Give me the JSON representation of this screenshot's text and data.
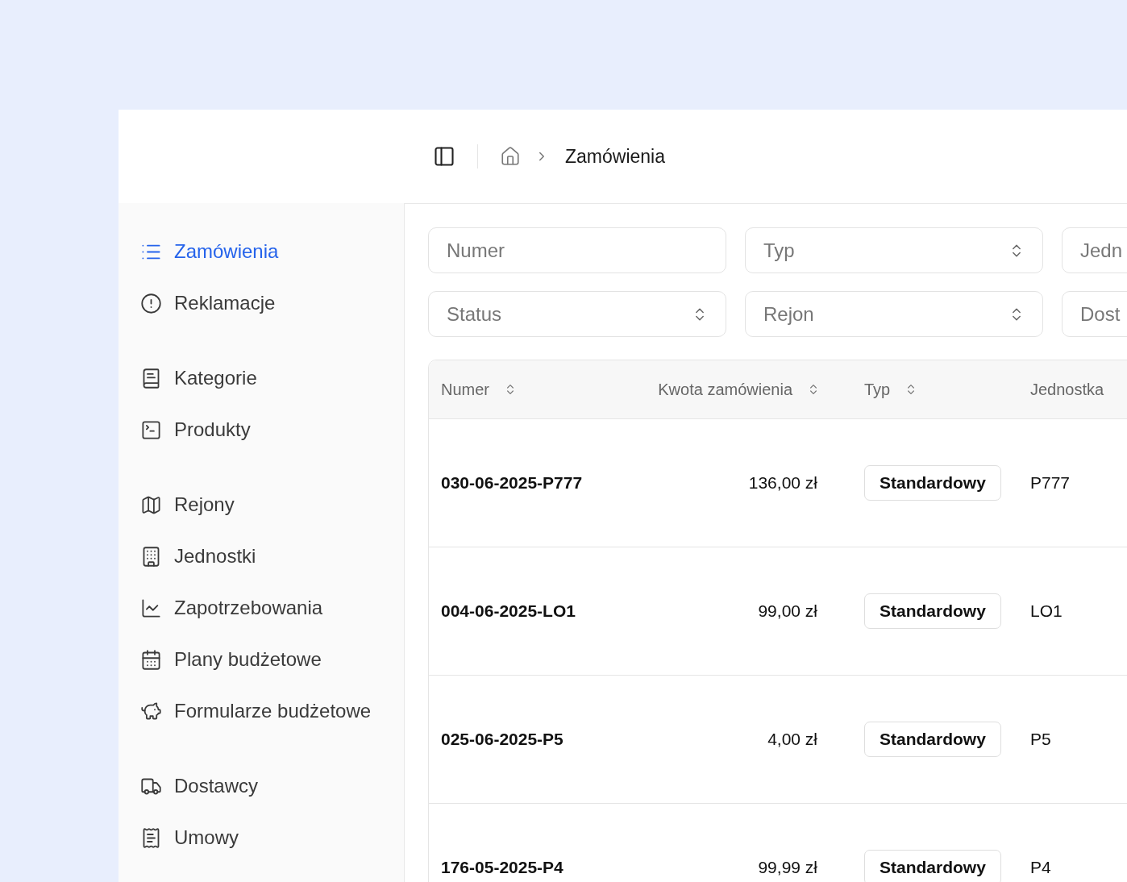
{
  "header": {
    "breadcrumb": {
      "current": "Zamówienia"
    }
  },
  "sidebar": {
    "groups": [
      {
        "items": [
          {
            "label": "Zamówienia",
            "selected": true
          },
          {
            "label": "Reklamacje",
            "selected": false
          }
        ]
      },
      {
        "items": [
          {
            "label": "Kategorie",
            "selected": false
          },
          {
            "label": "Produkty",
            "selected": false
          }
        ]
      },
      {
        "items": [
          {
            "label": "Rejony",
            "selected": false
          },
          {
            "label": "Jednostki",
            "selected": false
          },
          {
            "label": "Zapotrzebowania",
            "selected": false
          },
          {
            "label": "Plany budżetowe",
            "selected": false
          },
          {
            "label": "Formularze budżetowe",
            "selected": false
          }
        ]
      },
      {
        "items": [
          {
            "label": "Dostawcy",
            "selected": false
          },
          {
            "label": "Umowy",
            "selected": false
          }
        ]
      }
    ]
  },
  "filters": [
    {
      "kind": "text",
      "placeholder": "Numer"
    },
    {
      "kind": "select",
      "placeholder": "Typ"
    },
    {
      "kind": "text",
      "placeholder": "Jedn"
    },
    {
      "kind": "select",
      "placeholder": "Status"
    },
    {
      "kind": "select",
      "placeholder": "Rejon"
    },
    {
      "kind": "text",
      "placeholder": "Dost"
    }
  ],
  "table": {
    "columns": [
      {
        "label": "Numer",
        "sortable": true
      },
      {
        "label": "Kwota zamówienia",
        "sortable": true
      },
      {
        "label": "Typ",
        "sortable": true
      },
      {
        "label": "Jednostka",
        "sortable": false
      }
    ],
    "rows": [
      {
        "number": "030-06-2025-P777",
        "amount": "136,00 zł",
        "type": "Standardowy",
        "unit": "P777"
      },
      {
        "number": "004-06-2025-LO1",
        "amount": "99,00 zł",
        "type": "Standardowy",
        "unit": "LO1"
      },
      {
        "number": "025-06-2025-P5",
        "amount": "4,00 zł",
        "type": "Standardowy",
        "unit": "P5"
      },
      {
        "number": "176-05-2025-P4",
        "amount": "99,99 zł",
        "type": "Standardowy",
        "unit": "P4"
      }
    ]
  }
}
